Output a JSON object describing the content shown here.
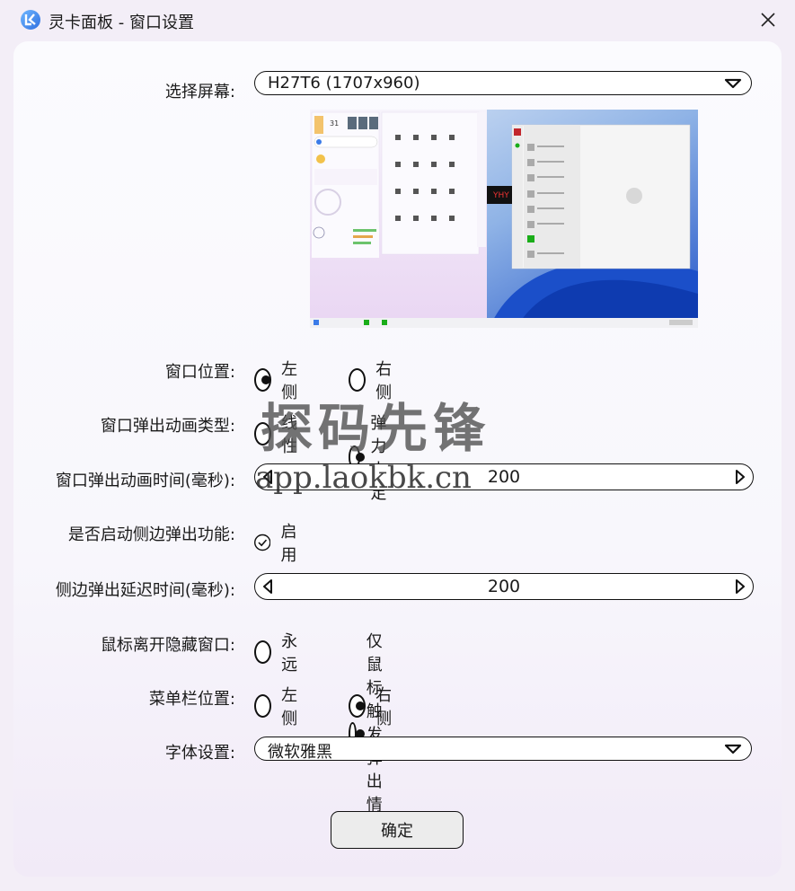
{
  "window": {
    "title": "灵卡面板 - 窗口设置"
  },
  "screen": {
    "label": "选择屏幕:",
    "value": "H27T6 (1707x960)"
  },
  "window_position": {
    "label": "窗口位置:",
    "options": [
      "左侧",
      "右侧"
    ],
    "selected": "左侧"
  },
  "anim_type": {
    "label": "窗口弹出动画类型:",
    "options": [
      "线性",
      "弹力十足"
    ],
    "selected": "弹力十足"
  },
  "anim_time": {
    "label": "窗口弹出动画时间(毫秒):",
    "value": "200"
  },
  "side_popup": {
    "label": "是否启动侧边弹出功能:",
    "option": "启用",
    "checked": true
  },
  "side_delay": {
    "label": "侧边弹出延迟时间(毫秒):",
    "value": "200"
  },
  "mouse_hide": {
    "label": "鼠标离开隐藏窗口:",
    "options": [
      "永远",
      "仅鼠标触发弹出情况"
    ],
    "selected": "仅鼠标触发弹出情况"
  },
  "menubar_pos": {
    "label": "菜单栏位置:",
    "options": [
      "左侧",
      "右侧"
    ],
    "selected": "右侧"
  },
  "font": {
    "label": "字体设置:",
    "value": "微软雅黑"
  },
  "ok_button": "确定",
  "watermark": {
    "text": "探码先锋",
    "url": "app.laokbk.cn"
  },
  "preview": {
    "date_number": "31",
    "clock": [
      "09",
      "57",
      "29"
    ],
    "promo_text": "YHY",
    "colors": {
      "panel": "#efe6f7",
      "desktop": "#3a7bd5",
      "accent": "#1aad19"
    }
  },
  "colors": {
    "bg": "#f3eef7",
    "card": "#fbfbfe",
    "border": "#111111",
    "button": "#ececec"
  }
}
